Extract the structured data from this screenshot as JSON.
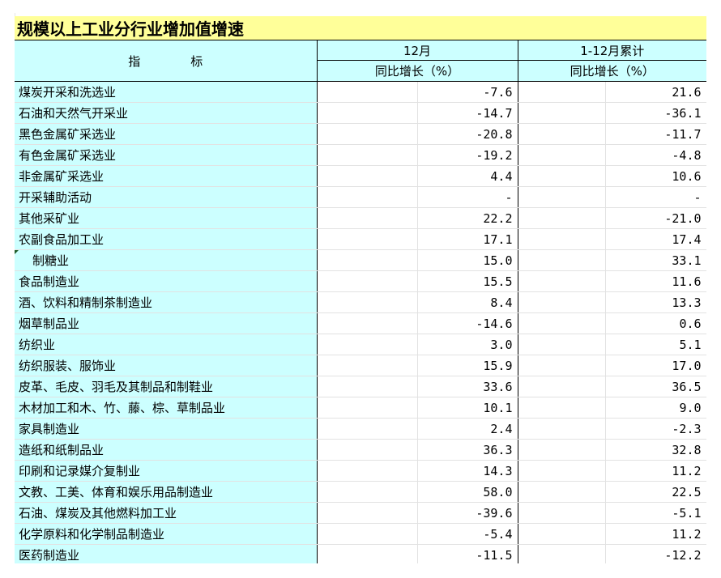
{
  "title": "规模以上工业分行业增加值增速",
  "header": {
    "indicator_chars": [
      "指",
      "标"
    ],
    "period_1": "12月",
    "period_2": "1-12月累计",
    "sub_1": "同比增长（%）",
    "sub_2": "同比增长（%）"
  },
  "rows": [
    {
      "name": "煤炭开采和洗选业",
      "dec": "-7.6",
      "ytd": "21.6"
    },
    {
      "name": "石油和天然气开采业",
      "dec": "-14.7",
      "ytd": "-36.1"
    },
    {
      "name": "黑色金属矿采选业",
      "dec": "-20.8",
      "ytd": "-11.7"
    },
    {
      "name": "有色金属矿采选业",
      "dec": "-19.2",
      "ytd": "-4.8"
    },
    {
      "name": "非金属矿采选业",
      "dec": "4.4",
      "ytd": "10.6"
    },
    {
      "name": "开采辅助活动",
      "dec": "-",
      "ytd": "-"
    },
    {
      "name": "其他采矿业",
      "dec": "22.2",
      "ytd": "-21.0"
    },
    {
      "name": "农副食品加工业",
      "dec": "17.1",
      "ytd": "17.4"
    },
    {
      "name": "制糖业",
      "dec": "15.0",
      "ytd": "33.1"
    },
    {
      "name": "食品制造业",
      "dec": "15.5",
      "ytd": "11.6"
    },
    {
      "name": "酒、饮料和精制茶制造业",
      "dec": "8.4",
      "ytd": "13.3"
    },
    {
      "name": "烟草制品业",
      "dec": "-14.6",
      "ytd": "0.6"
    },
    {
      "name": "纺织业",
      "dec": "3.0",
      "ytd": "5.1"
    },
    {
      "name": "纺织服装、服饰业",
      "dec": "15.9",
      "ytd": "17.0"
    },
    {
      "name": "皮革、毛皮、羽毛及其制品和制鞋业",
      "dec": "33.6",
      "ytd": "36.5"
    },
    {
      "name": "木材加工和木、竹、藤、棕、草制品业",
      "dec": "10.1",
      "ytd": "9.0"
    },
    {
      "name": "家具制造业",
      "dec": "2.4",
      "ytd": "-2.3"
    },
    {
      "name": "造纸和纸制品业",
      "dec": "36.3",
      "ytd": "32.8"
    },
    {
      "name": "印刷和记录媒介复制业",
      "dec": "14.3",
      "ytd": "11.2"
    },
    {
      "name": "文教、工美、体育和娱乐用品制造业",
      "dec": "58.0",
      "ytd": "22.5"
    },
    {
      "name": "石油、煤炭及其他燃料加工业",
      "dec": "-39.6",
      "ytd": "-5.1"
    },
    {
      "name": "化学原料和化学制品制造业",
      "dec": "-5.4",
      "ytd": "11.2"
    },
    {
      "name": "医药制造业",
      "dec": "-11.5",
      "ytd": "-12.2"
    }
  ]
}
